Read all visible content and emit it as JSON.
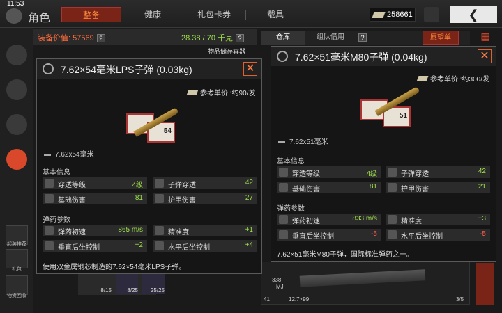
{
  "status": {
    "time": "11:53"
  },
  "header": {
    "title": "角色",
    "tabs": [
      "整备",
      "健康",
      "礼包卡券",
      "载具"
    ],
    "currency": "258661",
    "back_icon": "❮"
  },
  "sidebar": {
    "labels": [
      "起装推荐",
      "礼包",
      "物资回收"
    ]
  },
  "main": {
    "value_label": "装备价值: 57569",
    "weight": "28.38 / 70 千克",
    "storage_label": "物品储存容器",
    "right_tabs": [
      "仓库",
      "组队借用"
    ],
    "wish_button": "愿望单"
  },
  "tooltip_left": {
    "title": "7.62×54毫米LPS子弹 (0.03kg)",
    "price": "参考单价 :约90/发",
    "box_number": "54",
    "caliber": "7.62x54毫米",
    "basic_title": "基本信息",
    "basic_stats": [
      {
        "label": "穿透等级",
        "value": "4级",
        "color": "green"
      },
      {
        "label": "子弹穿透",
        "value": "42",
        "color": "green"
      },
      {
        "label": "基础伤害",
        "value": "81",
        "color": "green"
      },
      {
        "label": "护甲伤害",
        "value": "27",
        "color": "green"
      }
    ],
    "ammo_title": "弹药参数",
    "ammo_stats": [
      {
        "label": "弹药初速",
        "value": "865 m/s",
        "color": "green"
      },
      {
        "label": "精准度",
        "value": "+1",
        "color": "green"
      },
      {
        "label": "垂直后坐控制",
        "value": "+2",
        "color": "green"
      },
      {
        "label": "水平后坐控制",
        "value": "+4",
        "color": "green"
      }
    ],
    "description": "使用双金属钢芯制造的7.62×54毫米LPS子弹。"
  },
  "tooltip_right": {
    "title": "7.62×51毫米M80子弹 (0.04kg)",
    "price": "参考单价 :约300/发",
    "box_number": "51",
    "caliber": "7.62x51毫米",
    "basic_title": "基本信息",
    "basic_stats": [
      {
        "label": "穿透等级",
        "value": "4级",
        "color": "green"
      },
      {
        "label": "子弹穿透",
        "value": "42",
        "color": "green"
      },
      {
        "label": "基础伤害",
        "value": "81",
        "color": "green"
      },
      {
        "label": "护甲伤害",
        "value": "21",
        "color": "green"
      }
    ],
    "ammo_title": "弹药参数",
    "ammo_stats": [
      {
        "label": "弹药初速",
        "value": "833 m/s",
        "color": "green"
      },
      {
        "label": "精准度",
        "value": "+3",
        "color": "green"
      },
      {
        "label": "垂直后坐控制",
        "value": "-5",
        "color": "red"
      },
      {
        "label": "水平后坐控制",
        "value": "-5",
        "color": "red"
      }
    ],
    "description": "7.62×51毫米M80子弹，国际标准弹药之一。"
  },
  "bottom": {
    "slots": [
      "8/15",
      "8/25",
      "25/25"
    ],
    "weapon_count": "41",
    "weapon_ammo": "12.7×99",
    "weapon_pages": "3/5",
    "stack_count": "338",
    "weapon_tag": "MJ"
  },
  "colors": {
    "accent": "#d9482b",
    "green": "#9ee04a",
    "red": "#ff5a4a",
    "orange": "#ff6a3a"
  }
}
